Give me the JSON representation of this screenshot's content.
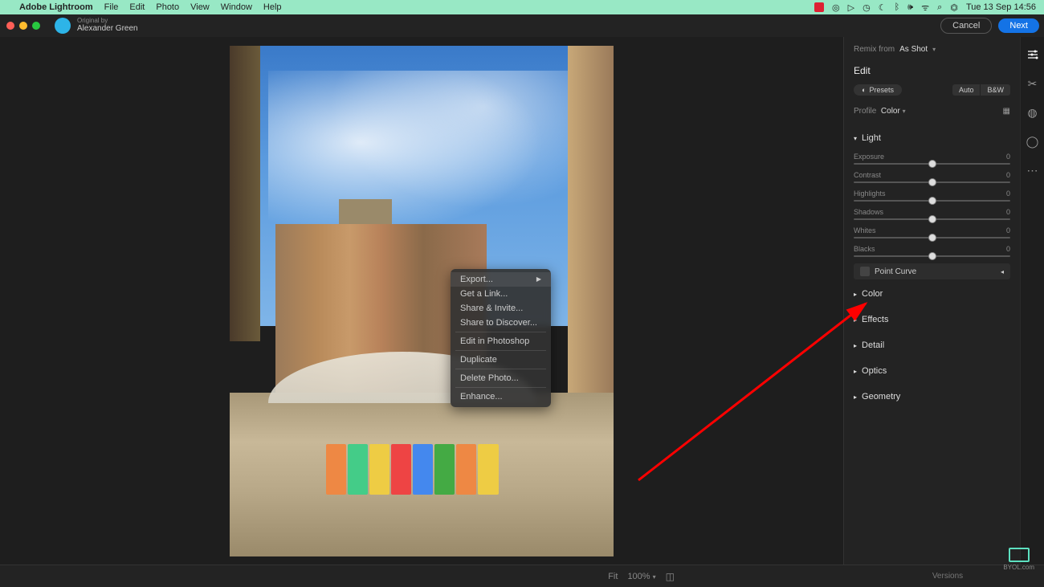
{
  "menubar": {
    "app_name": "Adobe Lightroom",
    "items": [
      "File",
      "Edit",
      "Photo",
      "View",
      "Window",
      "Help"
    ],
    "clock": "Tue 13 Sep  14:56"
  },
  "appbar": {
    "original_by_label": "Original by",
    "original_by_name": "Alexander Green",
    "cancel": "Cancel",
    "next": "Next"
  },
  "context_menu": {
    "items": [
      {
        "label": "Export...",
        "submenu": true
      },
      {
        "label": "Get a Link..."
      },
      {
        "label": "Share & Invite..."
      },
      {
        "label": "Share to Discover..."
      },
      {
        "sep": true
      },
      {
        "label": "Edit in Photoshop"
      },
      {
        "sep": true
      },
      {
        "label": "Duplicate"
      },
      {
        "sep": true
      },
      {
        "label": "Delete Photo..."
      },
      {
        "sep": true
      },
      {
        "label": "Enhance..."
      }
    ]
  },
  "panel": {
    "remix_label": "Remix from",
    "remix_value": "As Shot",
    "edit": "Edit",
    "presets": "Presets",
    "auto": "Auto",
    "bw": "B&W",
    "profile_label": "Profile",
    "profile_value": "Color",
    "light": {
      "title": "Light",
      "sliders": [
        {
          "name": "Exposure",
          "value": "0"
        },
        {
          "name": "Contrast",
          "value": "0"
        },
        {
          "name": "Highlights",
          "value": "0"
        },
        {
          "name": "Shadows",
          "value": "0"
        },
        {
          "name": "Whites",
          "value": "0"
        },
        {
          "name": "Blacks",
          "value": "0"
        }
      ],
      "point_curve": "Point Curve"
    },
    "sections": [
      "Color",
      "Effects",
      "Detail",
      "Optics",
      "Geometry"
    ]
  },
  "bottom": {
    "fit": "Fit",
    "zoom": "100%",
    "versions": "Versions"
  },
  "watermark": "BYOL.com"
}
